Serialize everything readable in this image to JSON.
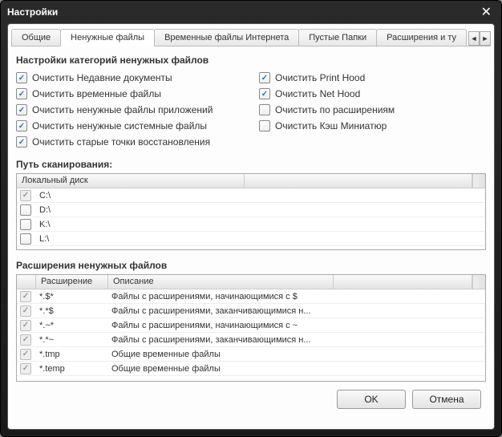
{
  "window": {
    "title": "Настройки"
  },
  "tabs": {
    "items": [
      {
        "label": "Общие",
        "active": false
      },
      {
        "label": "Ненужные файлы",
        "active": true
      },
      {
        "label": "Временные файлы Интернета",
        "active": false
      },
      {
        "label": "Пустые Папки",
        "active": false
      },
      {
        "label": "Расширения и ту",
        "active": false
      }
    ]
  },
  "section": {
    "title": "Настройки категорий ненужных файлов",
    "checks_left": [
      {
        "label": "Очистить Недавние документы",
        "checked": true
      },
      {
        "label": "Очистить временные файлы",
        "checked": true
      },
      {
        "label": "Очистить ненужные файлы приложений",
        "checked": true
      },
      {
        "label": "Очистить ненужные системные файлы",
        "checked": true
      },
      {
        "label": "Очистить старые точки восстановления",
        "checked": true
      }
    ],
    "checks_right": [
      {
        "label": "Очистить Print Hood",
        "checked": true
      },
      {
        "label": "Очистить Net Hood",
        "checked": true
      },
      {
        "label": "Очистить по расширениям",
        "checked": false
      },
      {
        "label": "Очистить Кэш Миниатюр",
        "checked": false
      }
    ]
  },
  "scan": {
    "title": "Путь сканирования:",
    "header": "Локальный диск",
    "rows": [
      {
        "label": "C:\\",
        "checked": true,
        "disabled": true
      },
      {
        "label": "D:\\",
        "checked": false
      },
      {
        "label": "K:\\",
        "checked": false
      },
      {
        "label": "L:\\",
        "checked": false
      }
    ]
  },
  "ext": {
    "title": "Расширения ненужных файлов",
    "headers": {
      "ext": "Расширение",
      "desc": "Описание"
    },
    "rows": [
      {
        "ext": "*.$*",
        "desc": "Файлы с расширениями, начинающимися с $",
        "checked": true
      },
      {
        "ext": "*.*$",
        "desc": "Файлы с расширениями, заканчивающимися н...",
        "checked": true
      },
      {
        "ext": "*.~*",
        "desc": "Файлы с расширениями, начинающимися с ~",
        "checked": true
      },
      {
        "ext": "*.*~",
        "desc": "Файлы с расширениями, заканчивающимися н...",
        "checked": true
      },
      {
        "ext": "*.tmp",
        "desc": "Общие временные файлы",
        "checked": true
      },
      {
        "ext": "*.temp",
        "desc": "Общие временные файлы",
        "checked": true
      }
    ]
  },
  "buttons": {
    "ok": "OK",
    "cancel": "Отмена"
  }
}
